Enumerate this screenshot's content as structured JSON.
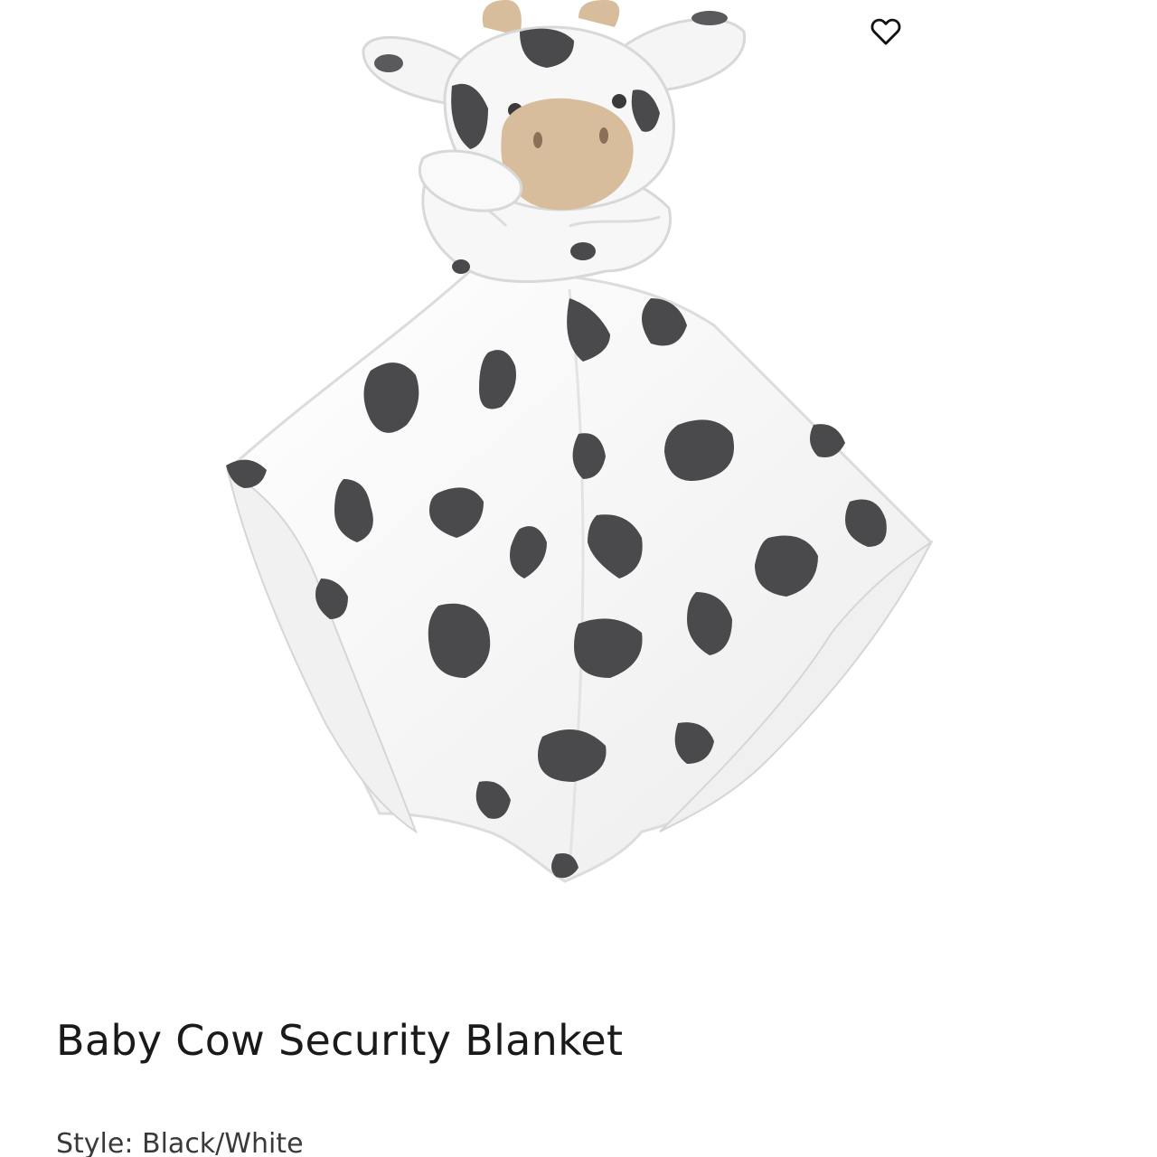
{
  "product": {
    "title": "Baby Cow Security Blanket",
    "style_label": "Style:",
    "style_value": "Black/White",
    "image_icon": "cow-security-blanket-photo"
  },
  "wishlist": {
    "icon": "heart-outline-icon"
  },
  "colors": {
    "background": "#ffffff",
    "text": "#1a1a1a",
    "spot": "#4a4a4c",
    "muzzle": "#d8bd9c"
  }
}
